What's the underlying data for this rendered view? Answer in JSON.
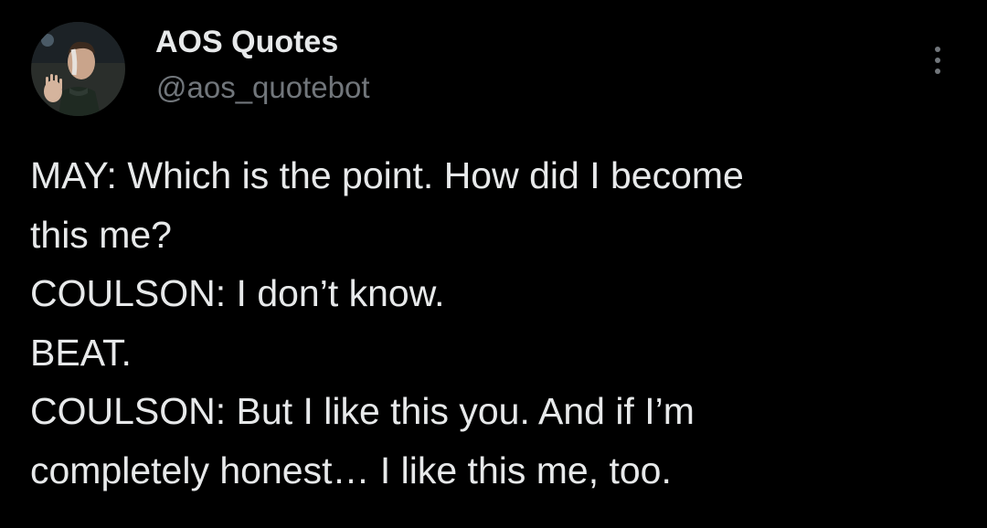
{
  "account": {
    "name": "AOS Quotes",
    "handle": "@aos_quotebot",
    "avatar_icon": "profile-photo"
  },
  "menu": {
    "icon": "more-vertical-icon"
  },
  "tweet": {
    "lines": [
      "MAY: Which is the point. How did I become",
      "this me?",
      "COULSON: I don’t know.",
      "BEAT.",
      "COULSON: But I like this you. And if I’m",
      "completely honest… I like this me, too."
    ]
  },
  "colors": {
    "background": "#000000",
    "primary_text": "#e7e9ea",
    "secondary_text": "#71767b"
  }
}
